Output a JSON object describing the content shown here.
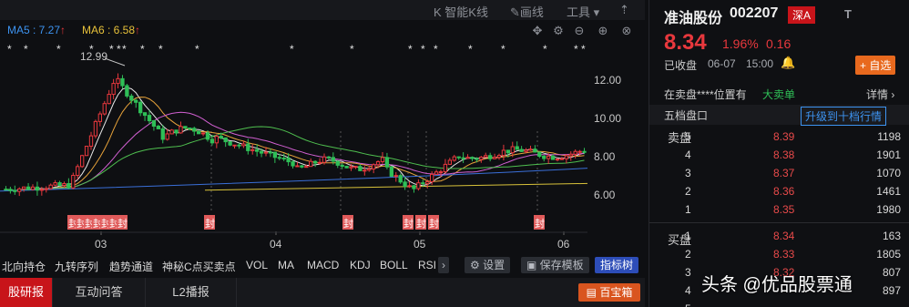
{
  "toolbar": {
    "smart_k": "K 智能K线",
    "draw": "画线",
    "tools": "工具"
  },
  "ma": {
    "ma5_label": "MA5 : 7.27",
    "ma6_label": "MA6 : 6.58"
  },
  "chart": {
    "high_marker": "12.99",
    "price_ticks": [
      "12.00",
      "10.00",
      "8.00",
      "6.00"
    ],
    "months": [
      "03",
      "04",
      "05",
      "06"
    ],
    "seal_char": "封"
  },
  "indicators": {
    "items": [
      "北向持仓",
      "九转序列",
      "趋势通道",
      "神秘C点买卖点",
      "VOL",
      "MA",
      "MACD",
      "KDJ",
      "BOLL",
      "RSI"
    ],
    "more": "›",
    "settings": "设置",
    "save_template": "保存模板",
    "indicator_tree": "指标树"
  },
  "bottom_tabs": {
    "research": "股研报",
    "qa": "互动问答",
    "l2": "L2播报",
    "treasure": "百宝箱"
  },
  "quote": {
    "name": "准油股份",
    "code": "002207",
    "market_badge": "深A",
    "t_flag": "T",
    "price": "8.34",
    "change_pct": "1.96%",
    "change": "0.16",
    "status": "已收盘",
    "date": "06-07",
    "time": "15:00",
    "add_watch": "+ 自选",
    "ask_line_prefix": "在卖盘****位置有",
    "big_sell": "大卖单",
    "detail": "详情",
    "order_book_title": "五档盘口",
    "upgrade": "升级到十档行情",
    "sell_label": "卖盘",
    "buy_label": "买盘",
    "asks": [
      {
        "level": "5",
        "price": "8.39",
        "vol": "1198"
      },
      {
        "level": "4",
        "price": "8.38",
        "vol": "1901"
      },
      {
        "level": "3",
        "price": "8.37",
        "vol": "1070"
      },
      {
        "level": "2",
        "price": "8.36",
        "vol": "1461"
      },
      {
        "level": "1",
        "price": "8.35",
        "vol": "1980"
      }
    ],
    "bids": [
      {
        "level": "1",
        "price": "8.34",
        "vol": "163"
      },
      {
        "level": "2",
        "price": "8.33",
        "vol": "1805"
      },
      {
        "level": "3",
        "price": "8.32",
        "vol": "807"
      },
      {
        "level": "4",
        "price": "",
        "vol": "897"
      },
      {
        "level": "5",
        "price": "",
        "vol": ""
      }
    ]
  },
  "watermark": "头条 @优品股票通",
  "colors": {
    "up": "#e8383d",
    "down": "#2fbf57",
    "accent": "#c8141a",
    "ma5": "#e8e8e8",
    "ma10": "#e8a33a",
    "ma20": "#d05fd0",
    "ma60": "#4fbf4f",
    "ma120": "#3a6fd8",
    "ma250": "#d8c23a"
  }
}
